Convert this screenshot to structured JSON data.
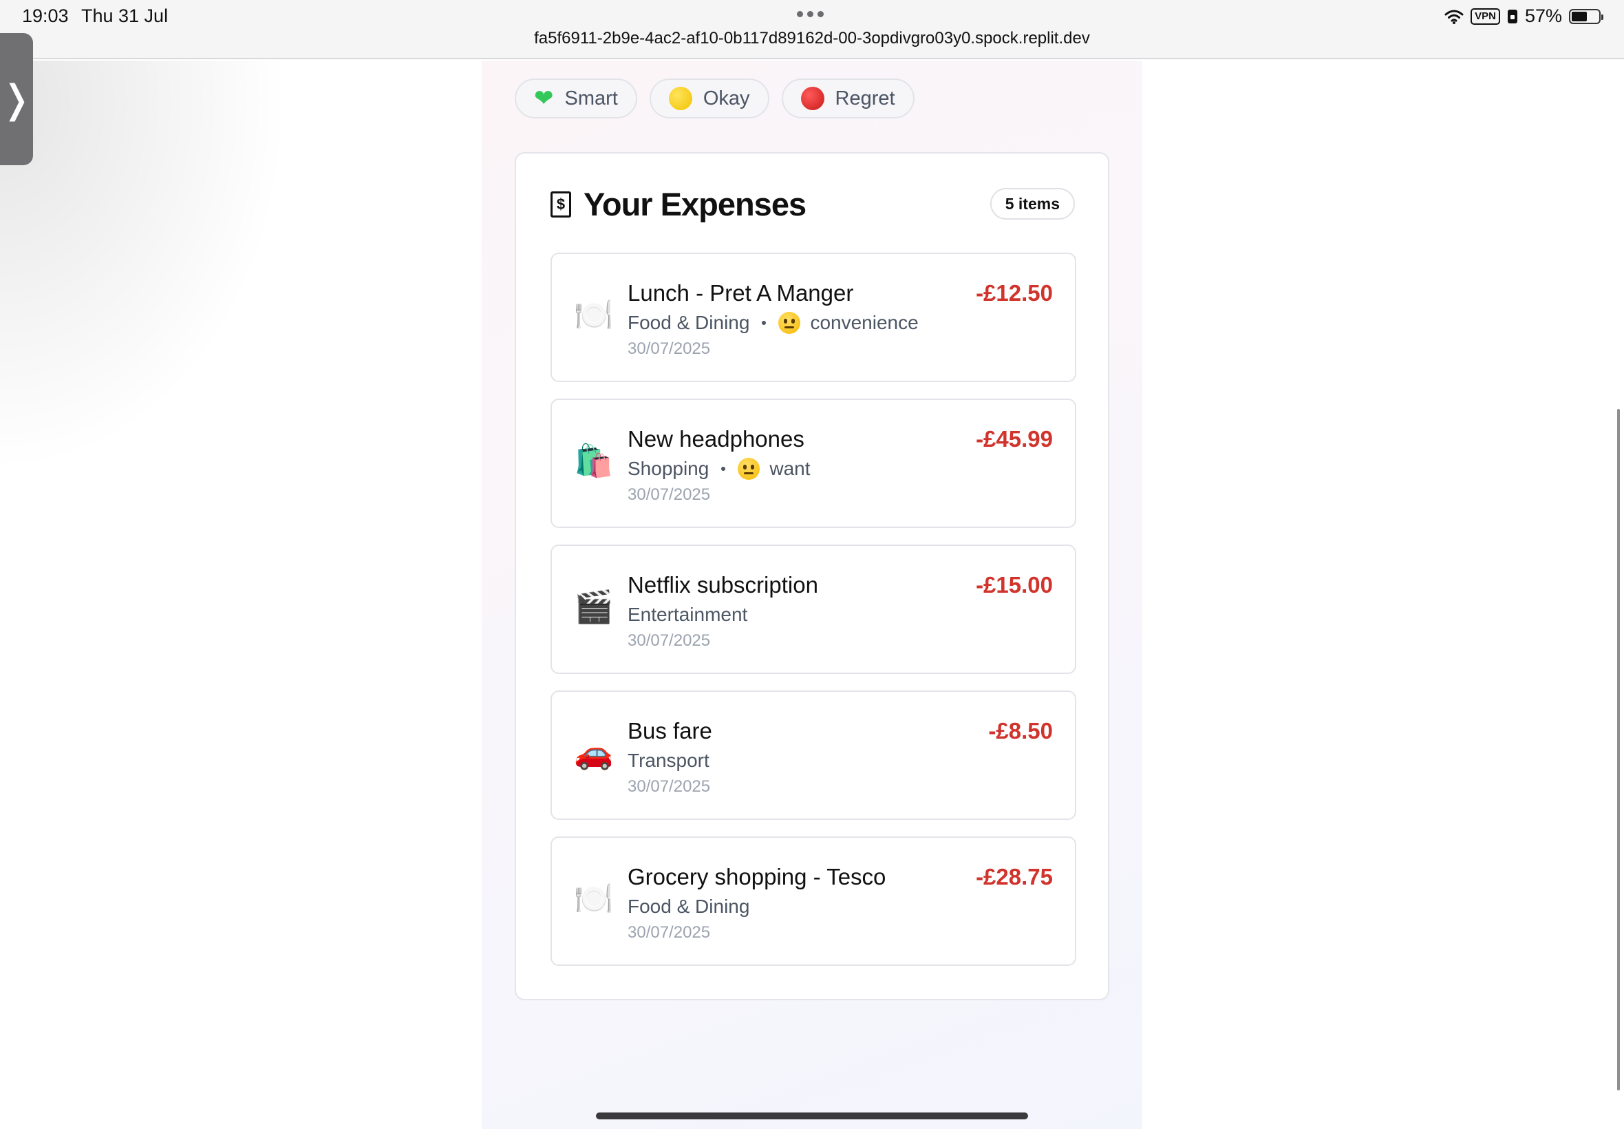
{
  "status_bar": {
    "time": "19:03",
    "date": "Thu 31 Jul",
    "url": "fa5f6911-2b9e-4ac2-af10-0b117d89162d-00-3opdivgro03y0.spock.replit.dev",
    "vpn": "VPN",
    "battery": "57%",
    "battery_level": 0.57
  },
  "sidebar_tab": {
    "glyph": "❭"
  },
  "filters": [
    {
      "label": "Smart",
      "icon": "green-heart-icon",
      "color": "#34c759"
    },
    {
      "label": "Okay",
      "icon": "yellow-circle-icon",
      "color": "#f2c200"
    },
    {
      "label": "Regret",
      "icon": "red-circle-icon",
      "color": "#c81818"
    }
  ],
  "expenses_card": {
    "title": "Your Expenses",
    "title_icon": "receipt-icon",
    "count_label": "5 items"
  },
  "expenses": [
    {
      "emoji": "🍽️",
      "icon": "plate-cutlery-icon",
      "title": "Lunch - Pret A Manger",
      "category": "Food & Dining",
      "mood": "convenience",
      "date": "30/07/2025",
      "amount": "-£12.50"
    },
    {
      "emoji": "🛍️",
      "icon": "shopping-bags-icon",
      "title": "New headphones",
      "category": "Shopping",
      "mood": "want",
      "date": "30/07/2025",
      "amount": "-£45.99"
    },
    {
      "emoji": "🎬",
      "icon": "clapperboard-icon",
      "title": "Netflix subscription",
      "category": "Entertainment",
      "mood": "",
      "date": "30/07/2025",
      "amount": "-£15.00"
    },
    {
      "emoji": "🚗",
      "icon": "car-icon",
      "title": "Bus fare",
      "category": "Transport",
      "mood": "",
      "date": "30/07/2025",
      "amount": "-£8.50"
    },
    {
      "emoji": "🍽️",
      "icon": "plate-cutlery-icon",
      "title": "Grocery shopping - Tesco",
      "category": "Food & Dining",
      "mood": "",
      "date": "30/07/2025",
      "amount": "-£28.75"
    }
  ],
  "colors": {
    "amount_negative": "#d0342c",
    "muted_text": "#4b5563",
    "date_text": "#9ca3af"
  }
}
